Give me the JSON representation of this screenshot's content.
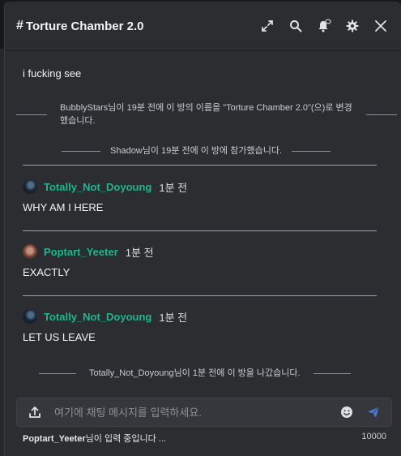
{
  "header": {
    "hash_symbol": "#",
    "title": "Torture Chamber 2.0",
    "icons": [
      "expand-icon",
      "search-icon",
      "bell-icon",
      "gear-icon",
      "close-icon"
    ]
  },
  "messages": {
    "first_text": "i fucking see",
    "system_rename": "BubblyStars님이 19분 전에 이 방의 이름을 \"Torture Chamber 2.0\"(으)로 변경했습니다.",
    "system_join": "Shadow님이 19분 전에 이 방에 참가했습니다.",
    "posts": [
      {
        "user": "Totally_Not_Doyoung",
        "time": "1분 전",
        "text": "WHY AM I HERE"
      },
      {
        "user": "Poptart_Yeeter",
        "time": "1분 전",
        "text": "EXACTLY"
      },
      {
        "user": "Totally_Not_Doyoung",
        "time": "1분 전",
        "text": "LET US LEAVE"
      }
    ],
    "system_leave": "Totally_Not_Doyoung님이 1분 전에 이 방을 나갔습니다."
  },
  "composer": {
    "placeholder": "여기에 채팅 메시지를 입력하세요.",
    "value": ""
  },
  "footer": {
    "typing_user": "Poptart_Yeeter",
    "typing_suffix": "님이 입력 중입니다 ...",
    "char_limit": "10000"
  },
  "colors": {
    "username": "#1fb58f",
    "send": "#4a7bd8",
    "panel_bg": "#2b2d31"
  }
}
